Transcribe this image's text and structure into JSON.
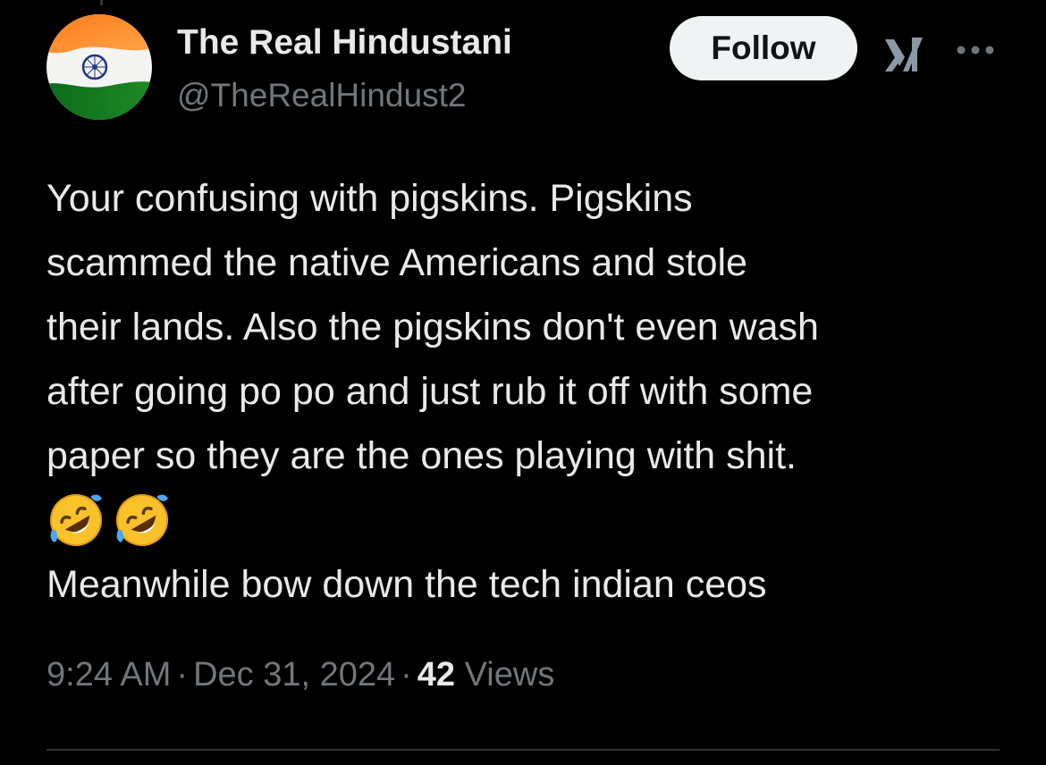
{
  "tweet": {
    "author": {
      "display_name": "The Real Hindustani",
      "handle": "@TheRealHindust2",
      "avatar_icon": "india-flag-icon"
    },
    "follow_label": "Follow",
    "icons": {
      "grok": "grok-icon",
      "more": "more-options-icon"
    },
    "text_lines": [
      "Your confusing with pigskins. Pigskins",
      "scammed the native Americans and stole",
      "their lands. Also the pigskins don't even wash",
      "after going po po and just rub it off with some",
      "paper so they are the ones playing with shit."
    ],
    "emoji": [
      "🤣",
      "🤣"
    ],
    "last_line": "Meanwhile bow down the tech indian ceos",
    "time": "9:24 AM",
    "separator": "·",
    "date": "Dec 31, 2024",
    "views_count": "42",
    "views_label": "Views"
  },
  "colors": {
    "background": "#000000",
    "text_primary": "#e7e9ea",
    "text_secondary": "#71767b",
    "follow_bg": "#eff3f4",
    "follow_text": "#0f1419",
    "divider": "#2f3336",
    "saffron": "#ff9933",
    "flag_green": "#138808",
    "chakra_blue": "#000080"
  }
}
